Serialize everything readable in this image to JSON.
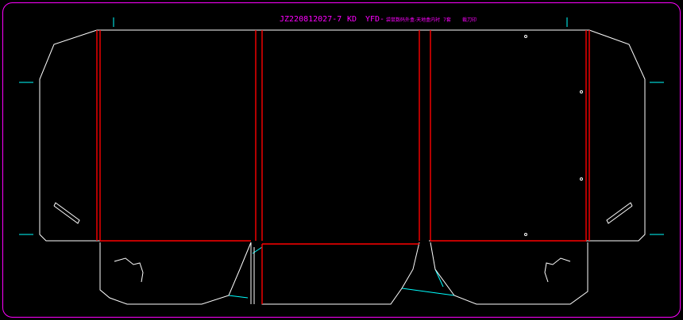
{
  "header": {
    "code": "JZ220812027-7",
    "kd": "KD",
    "product": "YFD-",
    "desc": "袋鼠数码外盒-天地盒内衬",
    "qty": "7套",
    "extra": "裁刀印"
  },
  "colors": {
    "background": "#000000",
    "border": "#ff00ff",
    "cut": "#ffffff",
    "crease": "#ff0000",
    "guide": "#00ffff",
    "title": "#ff00ff"
  }
}
